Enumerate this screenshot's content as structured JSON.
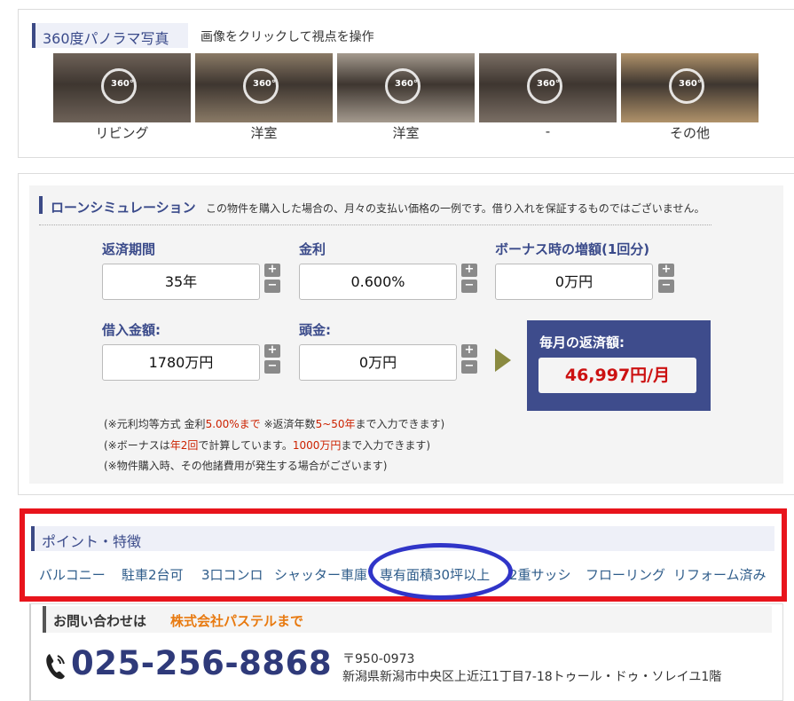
{
  "panorama": {
    "title": "360度パノラマ写真",
    "instruction": "画像をクリックして視点を操作",
    "badge": "360°",
    "items": [
      {
        "label": "リビング",
        "color": "#6e6258"
      },
      {
        "label": "洋室",
        "color": "#8a7a66"
      },
      {
        "label": "洋室",
        "color": "#a49a8e"
      },
      {
        "label": "-",
        "color": "#7a6e64"
      },
      {
        "label": "その他",
        "color": "#b0926a"
      }
    ]
  },
  "loan": {
    "title": "ローンシミュレーション",
    "description": "この物件を購入した場合の、月々の支払い価格の一例です。借り入れを保証するものではございません。",
    "fields": {
      "period": {
        "label": "返済期間",
        "value": "35年"
      },
      "rate": {
        "label": "金利",
        "value": "0.600%"
      },
      "bonus": {
        "label": "ボーナス時の増額(1回分)",
        "value": "0万円"
      },
      "amount": {
        "label": "借入金額:",
        "value": "1780万円"
      },
      "down": {
        "label": "頭金:",
        "value": "0万円"
      }
    },
    "plus": "+",
    "minus": "−",
    "result": {
      "label": "毎月の返済額:",
      "value": "46,997円/月"
    },
    "notes": {
      "n1a": "(※元利均等方式 金利",
      "n1b": "5.00%まで",
      "n1c": " ※返済年数",
      "n1d": "5~50年",
      "n1e": "まで入力できます)",
      "n2a": "(※ボーナスは",
      "n2b": "年2回",
      "n2c": "で計算しています。",
      "n2d": "1000万円",
      "n2e": "まで入力できます)",
      "n3": "(※物件購入時、その他諸費用が発生する場合がございます)"
    }
  },
  "features": {
    "title": "ポイント・特徴",
    "tags": [
      "バルコニー",
      "駐車2台可",
      "3口コンロ",
      "シャッター車庫",
      "専有面積30坪以上",
      "2重サッシ",
      "フローリング",
      "リフォーム済み"
    ]
  },
  "contact": {
    "prefix": "お問い合わせは",
    "company": "株式会社パステルまで",
    "phone": "025-256-8868",
    "postal": "〒950-0973",
    "address": "新潟県新潟市中央区上近江1丁目7-18トゥール・ドゥ・ソレイユ1階"
  },
  "colors": {
    "accent": "#3c4a86",
    "result_bg": "#3e4c8c",
    "result_value": "#cc1111",
    "highlight_red": "#e8141c",
    "highlight_blue": "#3035c8",
    "company": "#e87a10"
  }
}
